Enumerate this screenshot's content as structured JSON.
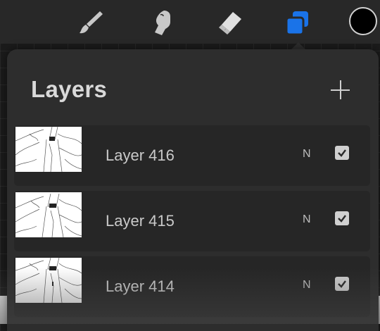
{
  "toolbar": {
    "tools": [
      {
        "name": "paint-brush",
        "icon": "brush-icon",
        "active": false
      },
      {
        "name": "smudge",
        "icon": "smudge-finger-icon",
        "active": false
      },
      {
        "name": "eraser",
        "icon": "eraser-icon",
        "active": false
      },
      {
        "name": "layers",
        "icon": "layers-icon",
        "active": true
      }
    ],
    "accent_color": "#1a73e8",
    "current_color": "#000000"
  },
  "layers_panel": {
    "title": "Layers",
    "add_icon": "plus-icon",
    "layers": [
      {
        "name": "Layer 416",
        "blend_mode": "N",
        "visible": true
      },
      {
        "name": "Layer 415",
        "blend_mode": "N",
        "visible": true
      },
      {
        "name": "Layer 414",
        "blend_mode": "N",
        "visible": true
      }
    ]
  }
}
